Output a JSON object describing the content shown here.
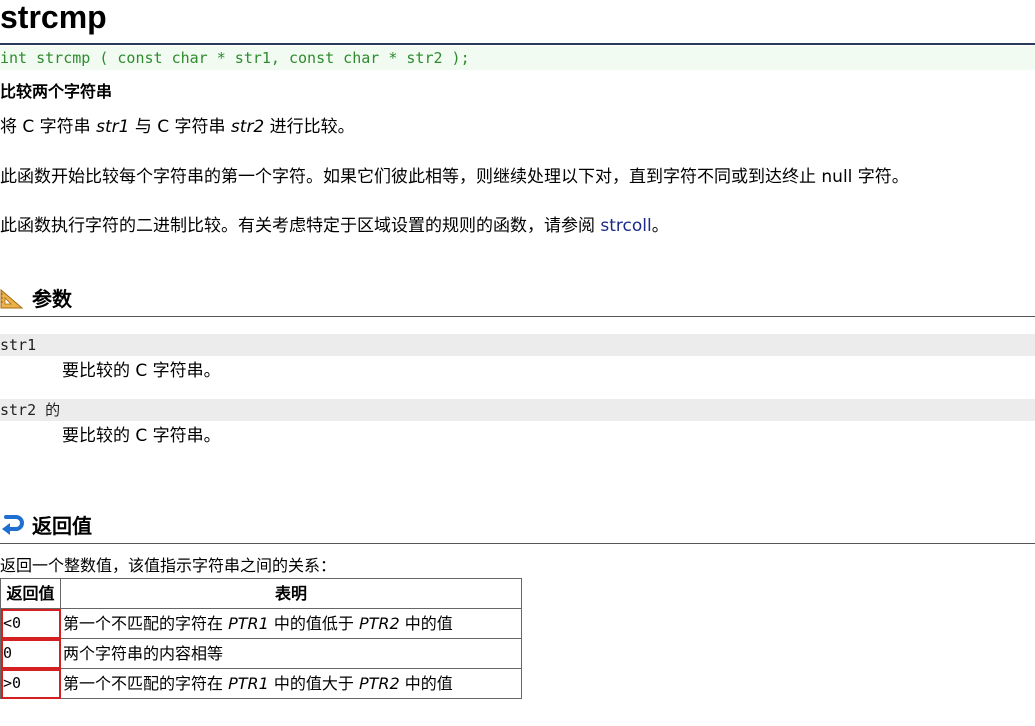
{
  "page": {
    "title": "strcmp",
    "prototype": "int strcmp ( const char * str1, const char * str2 );",
    "summary": "比较两个字符串"
  },
  "description": {
    "p1_before": "将 C 字符串 ",
    "p1_arg1": "str1",
    "p1_mid": " 与 C 字符串 ",
    "p1_arg2": "str2",
    "p1_after": " 进行比较。",
    "p2": "此函数开始比较每个字符串的第一个字符。如果它们彼此相等，则继续处理以下对，直到字符不同或到达终止 null 字符。",
    "p3_before": "此函数执行字符的二进制比较。有关考虑特定于区域设置的规则的函数，请参阅 ",
    "p3_link": "strcoll",
    "p3_after": "。"
  },
  "parameters": {
    "heading": "参数",
    "icon": "set-square-icon",
    "items": [
      {
        "name": "str1",
        "desc": "要比较的 C 字符串。"
      },
      {
        "name": "str2 的",
        "desc": "要比较的 C 字符串。"
      }
    ]
  },
  "return_value": {
    "heading": "返回值",
    "icon": "return-arrow-icon",
    "intro": "返回一个整数值，该值指示字符串之间的关系：",
    "table": {
      "headers": [
        "返回值",
        "表明"
      ],
      "rows": [
        {
          "value": "<0",
          "d_before": "第一个不匹配的字符在 ",
          "d_arg1": "PTR1",
          "d_mid": " 中的值低于 ",
          "d_arg2": "PTR2",
          "d_after": " 中的值"
        },
        {
          "value": "0",
          "d_text": "两个字符串的内容相等"
        },
        {
          "value": ">0",
          "d_before": "第一个不匹配的字符在 ",
          "d_arg1": "PTR1",
          "d_mid": " 中的值大于 ",
          "d_arg2": "PTR2",
          "d_after": " 中的值"
        }
      ]
    }
  },
  "colors": {
    "title_rule": "#2a3a5a",
    "prototype_text": "#2e8b2e",
    "prototype_bg": "#f2fbf2",
    "link": "#1b2a8a",
    "highlight_box": "#d42020",
    "param_bg": "#ececec"
  }
}
